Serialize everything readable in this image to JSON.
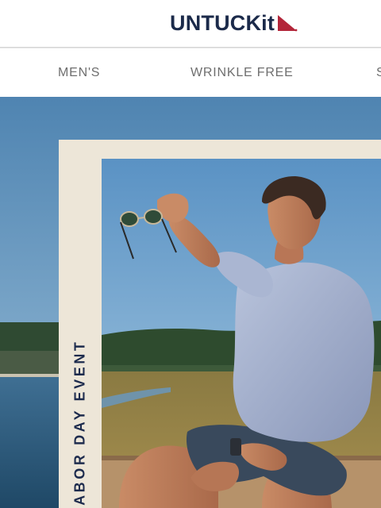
{
  "brand": {
    "name": "UNTUCKit",
    "logo_text": "UNTUCKit",
    "logo_mark_icon": "triangle-pennant-icon",
    "colors": {
      "navy": "#1b2a4a",
      "red": "#b3263a"
    }
  },
  "nav": {
    "items": [
      {
        "label": "MEN'S"
      },
      {
        "label": "WRINKLE FREE"
      },
      {
        "label": "S"
      }
    ]
  },
  "hero": {
    "badge_text": "LABOR DAY EVENT",
    "image_icon": "man-holding-sunglasses-photo"
  }
}
